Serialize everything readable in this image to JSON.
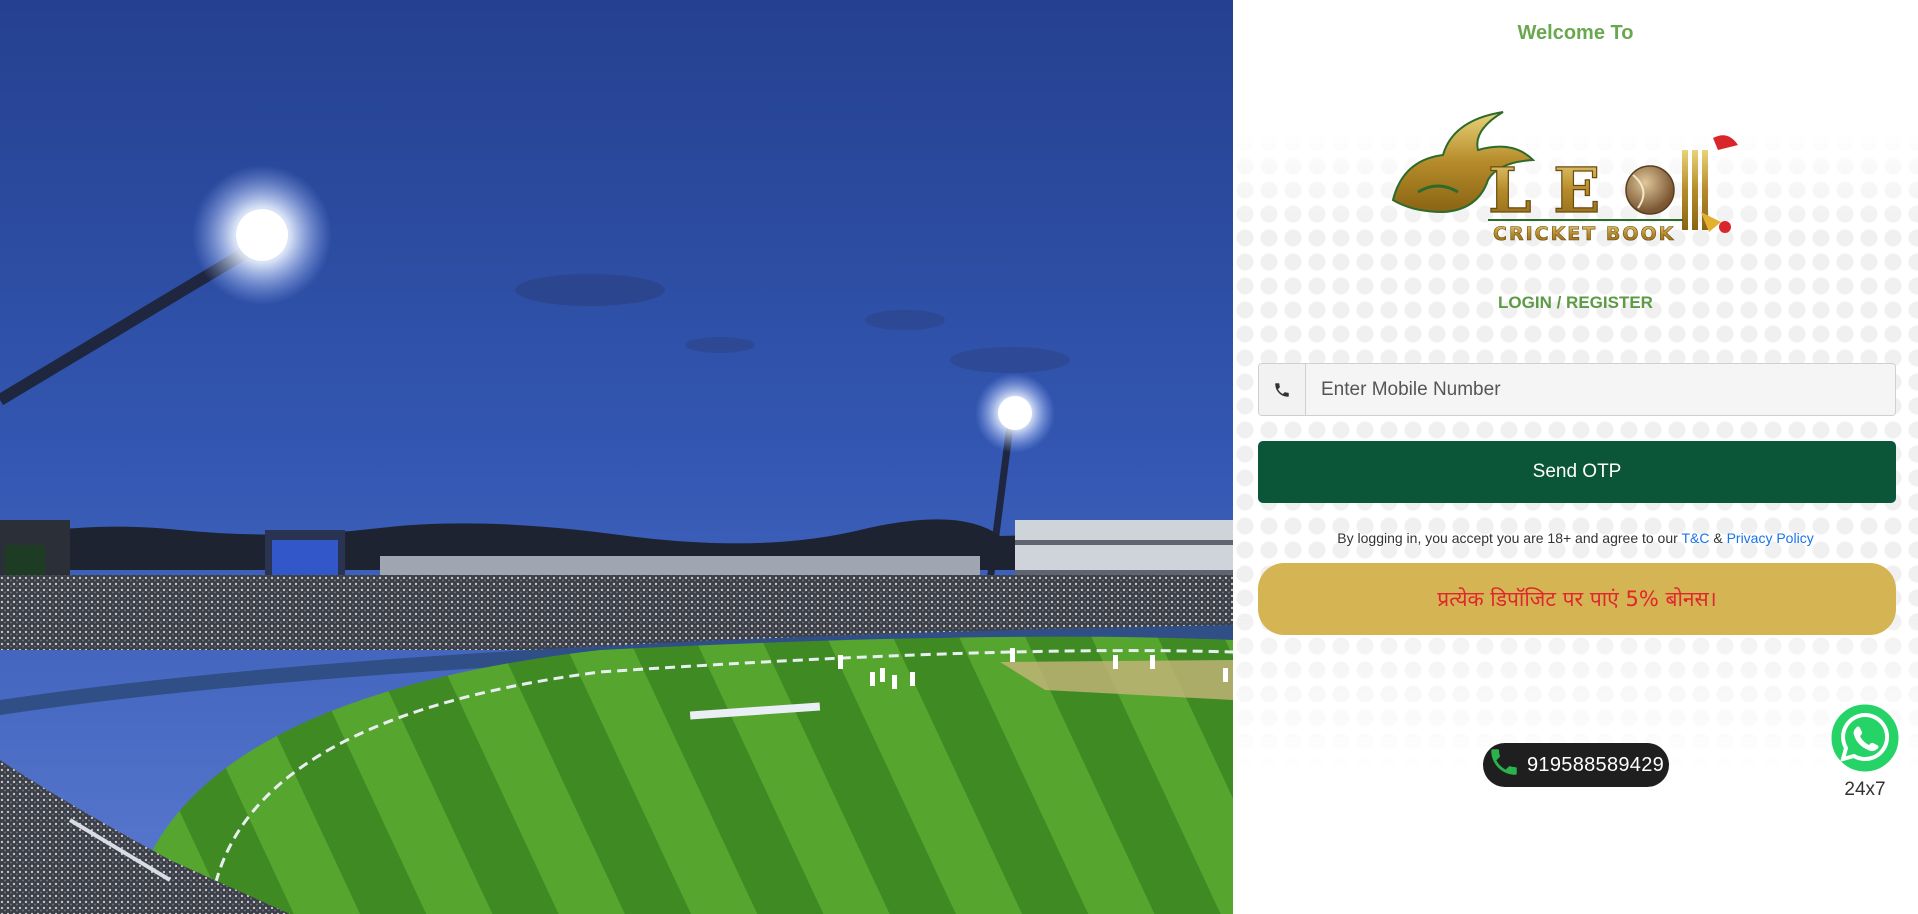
{
  "panel": {
    "welcome_text": "Welcome To",
    "logo": {
      "wordmark": "LEO",
      "tagline": "CRICKET BOOK"
    },
    "login_register_text": "LOGIN / REGISTER",
    "mobile_input": {
      "placeholder": "Enter Mobile Number",
      "value": ""
    },
    "send_otp_label": "Send OTP",
    "terms": {
      "prefix": "By logging in, you accept you are 18+ and agree to our",
      "tc_link": "T&C",
      "amp": "&",
      "privacy_link": "Privacy Policy"
    },
    "bonus_banner": "प्रत्येक डिपॉजिट पर पाएं 5% बोनस।",
    "call": {
      "phone_number": "919588589429"
    },
    "whatsapp": {
      "label": "24x7"
    }
  },
  "colors": {
    "accent_green": "#6aa84f",
    "primary_button": "#0b5539",
    "bonus_background": "#d4b453",
    "bonus_text": "#e0262f",
    "link": "#1a73e8",
    "whatsapp": "#25d366"
  },
  "icons": {
    "phone_addon": "phone-icon",
    "call": "phone-icon",
    "whatsapp": "whatsapp-icon"
  }
}
